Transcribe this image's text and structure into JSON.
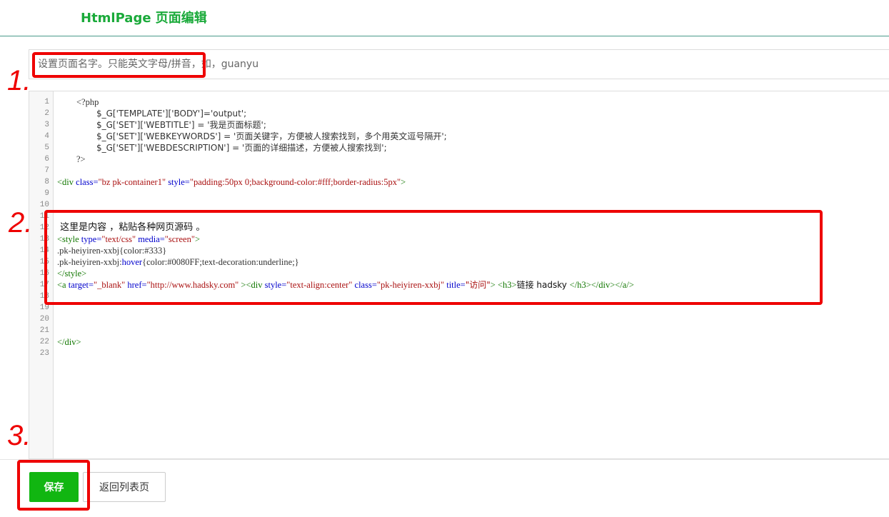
{
  "header": {
    "title": "HtmlPage 页面编辑"
  },
  "name_field": {
    "placeholder": "设置页面名字。只能英文字母/拼音，如，guanyu",
    "value": ""
  },
  "editor": {
    "line_numbers": [
      "1",
      "2",
      "3",
      "4",
      "5",
      "6",
      "7",
      "8",
      "9",
      "10",
      "11",
      "12",
      "13",
      "14",
      "15",
      "16",
      "17",
      "18",
      "19",
      "20",
      "21",
      "22",
      "23"
    ],
    "lines": {
      "l1": "<?php",
      "l2": "$_G['TEMPLATE']['BODY']='output';",
      "l3": "$_G['SET']['WEBTITLE'] = '我是页面标题';",
      "l4": "$_G['SET']['WEBKEYWORDS'] = '页面关键字，方便被人搜索找到，多个用英文逗号隔开';",
      "l5": "$_G['SET']['WEBDESCRIPTION'] = '页面的详细描述，方便被人搜索找到';",
      "l6": "?>",
      "l8": {
        "open": "<div",
        "a1": " class=",
        "v1": "\"bz pk-container1\"",
        "a2": " style=",
        "v2": "\"padding:50px 0;background-color:#fff;border-radius:5px\"",
        "close": ">"
      },
      "l12": " 这里是内容 ，粘贴各种网页源码 。",
      "l13": {
        "open": "<style",
        "a1": " type=",
        "v1": "\"text/css\"",
        "a2": " media=",
        "v2": "\"screen\"",
        "close": ">"
      },
      "l14": ".pk-heiyiren-xxbj{color:#333}",
      "l15": {
        "sel": ".pk-heiyiren-xxbj:",
        "pseudo": "hover",
        "rule": "{color:#0080FF;text-decoration:underline;}"
      },
      "l16": "</style>",
      "l17": {
        "a_open": "<a",
        "a1": " target=",
        "v1": "\"_blank\"",
        "a2": " href=",
        "v2": "\"http://www.hadsky.com\"",
        "gt1": " >",
        "div_open": "<div",
        "a3": " style=",
        "v3": "\"text-align:center\"",
        "a4": " class=",
        "v4": "\"pk-heiyiren-xxbj\"",
        "a5": " title=",
        "v5": "\"访问\"",
        "gt2": ">",
        "h3_open": " <h3>",
        "text": "链接 hadsky ",
        "close_tags": "</h3></div></a/>"
      },
      "l22": "</div>"
    }
  },
  "footer": {
    "save_label": "保存",
    "back_label": "返回列表页"
  },
  "annotations": {
    "n1": "1.",
    "n2": "2.",
    "n3": "3."
  },
  "colors": {
    "accent": "#11b611",
    "title": "#1aaa3a",
    "annotation": "#ee0000"
  }
}
